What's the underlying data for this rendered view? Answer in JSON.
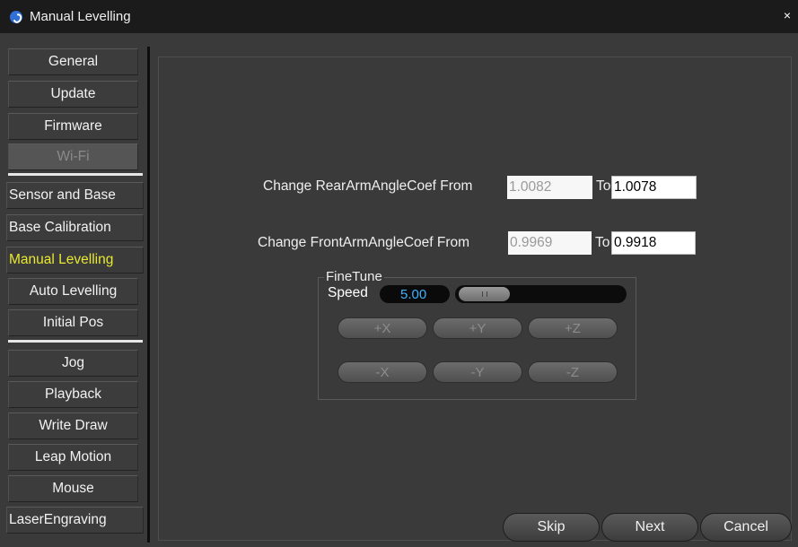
{
  "window": {
    "title": "Manual Levelling",
    "close_glyph": "×"
  },
  "sidebar": {
    "items": [
      {
        "label": "General",
        "state": "normal"
      },
      {
        "label": "Update",
        "state": "normal"
      },
      {
        "label": "Firmware",
        "state": "normal"
      },
      {
        "label": "Wi-Fi",
        "state": "disabled"
      },
      {
        "label": "Sensor and Base",
        "state": "normal"
      },
      {
        "label": "Base Calibration",
        "state": "normal"
      },
      {
        "label": "Manual Levelling",
        "state": "active"
      },
      {
        "label": "Auto Levelling",
        "state": "normal"
      },
      {
        "label": "Initial Pos",
        "state": "normal"
      },
      {
        "label": "Jog",
        "state": "normal"
      },
      {
        "label": "Playback",
        "state": "normal"
      },
      {
        "label": "Write  Draw",
        "state": "normal"
      },
      {
        "label": "Leap Motion",
        "state": "normal"
      },
      {
        "label": "Mouse",
        "state": "normal"
      },
      {
        "label": "LaserEngraving",
        "state": "normal"
      }
    ]
  },
  "coefficients": {
    "rear": {
      "label": "Change RearArmAngleCoef From",
      "from_value": "1.0082",
      "to_label": "To",
      "to_value": "1.0078"
    },
    "front": {
      "label": "Change FrontArmAngleCoef From",
      "from_value": "0.9969",
      "to_label": "To",
      "to_value": "0.9918"
    }
  },
  "finetune": {
    "title": "FineTune",
    "speed_label": "Speed",
    "speed_value": "5.00",
    "buttons_row1": [
      "+X",
      "+Y",
      "+Z"
    ],
    "buttons_row2": [
      "-X",
      "-Y",
      "-Z"
    ]
  },
  "actions": {
    "skip": "Skip",
    "next": "Next",
    "cancel": "Cancel"
  },
  "colors": {
    "active_nav_text": "#e8e832",
    "speed_text": "#3fb3ff",
    "background": "#3a3a3a",
    "titlebar": "#1b1b1b"
  }
}
